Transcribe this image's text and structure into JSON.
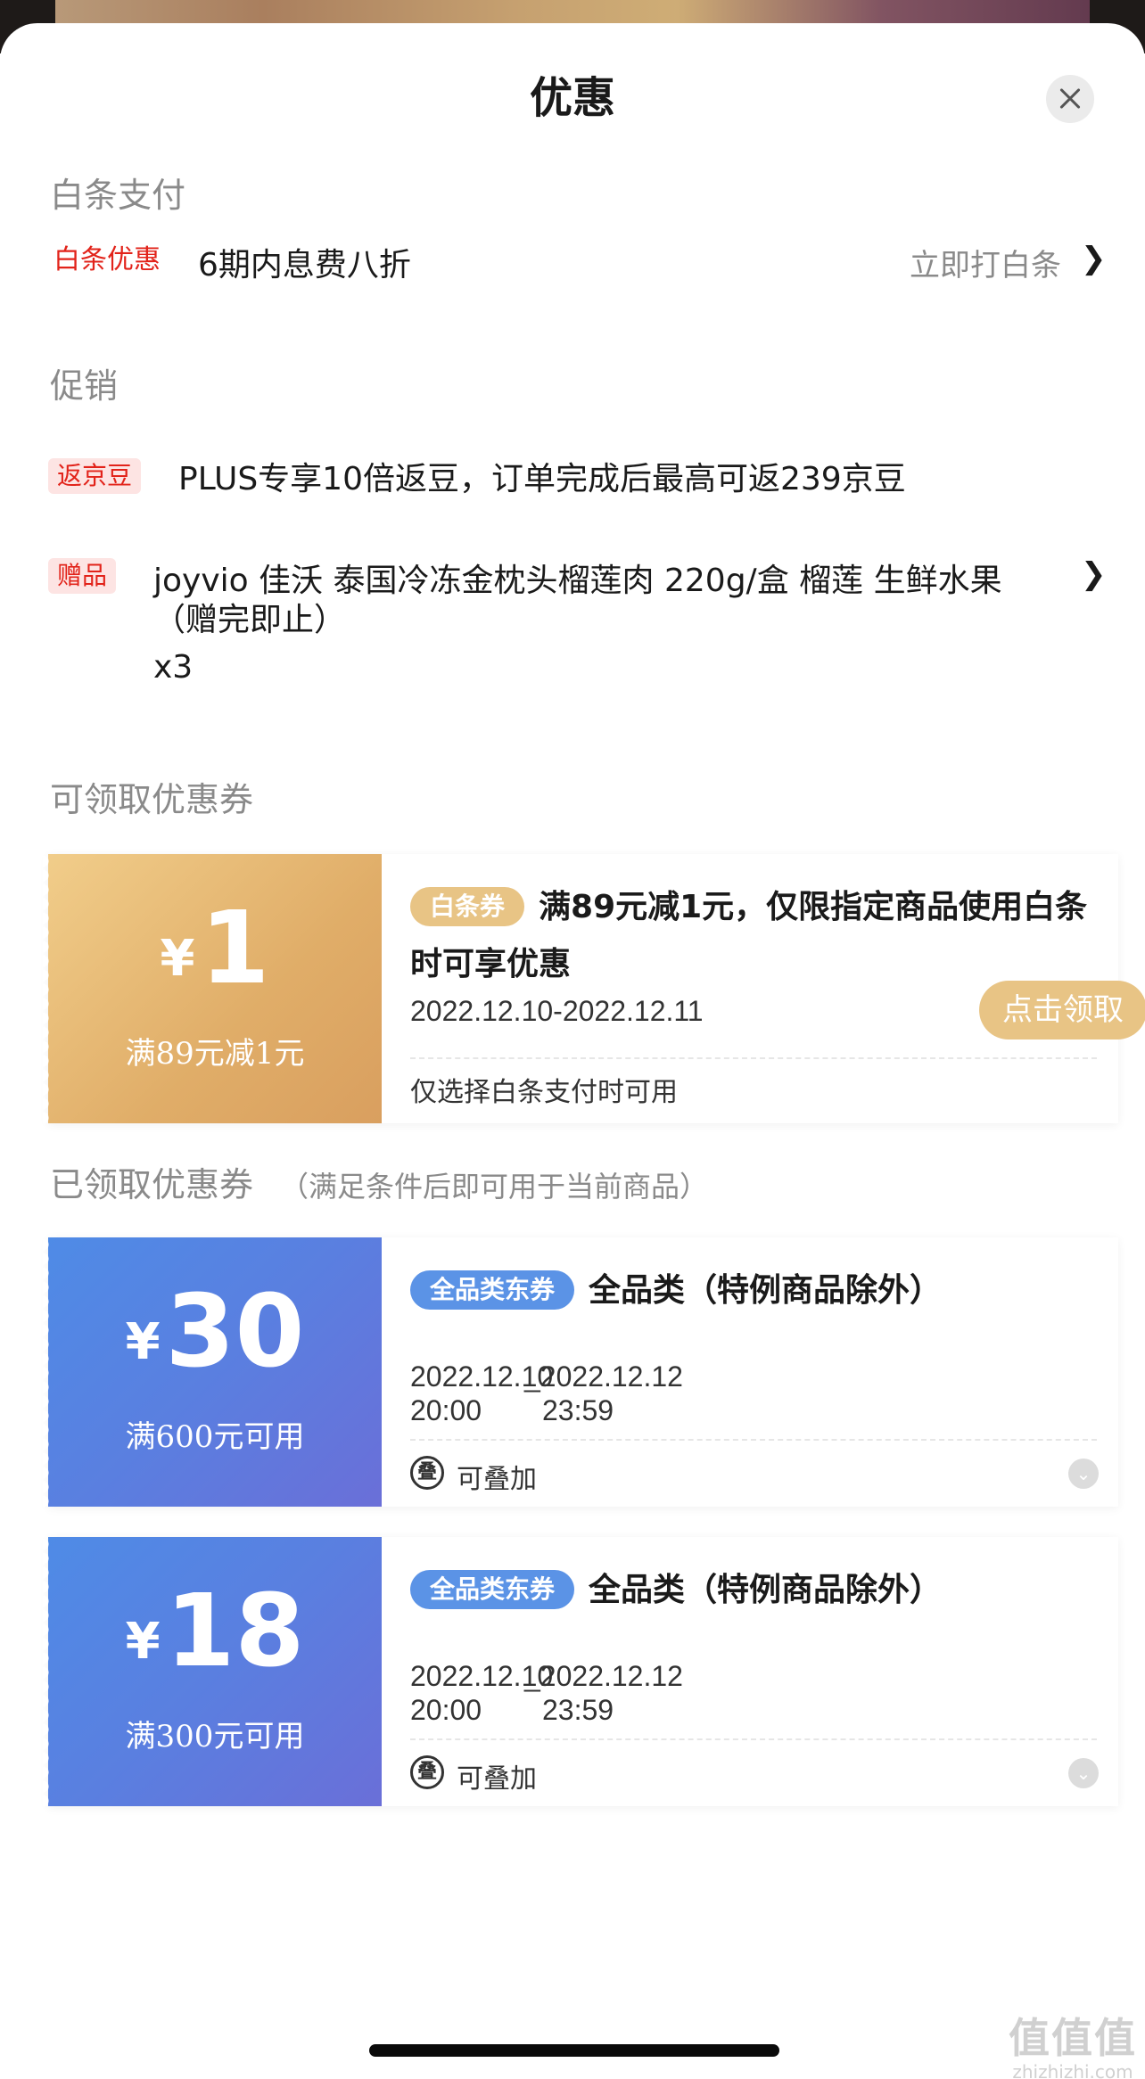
{
  "header": {
    "title": "优惠"
  },
  "baitiao": {
    "section_label": "白条支付",
    "tag": "白条优惠",
    "text": "6期内息费八折",
    "action": "立即打白条",
    "chevron": "❯"
  },
  "promo": {
    "section_label": "促销",
    "items": [
      {
        "tag": "返京豆",
        "text": "PLUS专享10倍返豆，订单完成后最高可返239京豆"
      },
      {
        "tag": "赠品",
        "line1": "joyvio 佳沃 泰国冷冻金枕头榴莲肉 220g/盒 榴莲 生鲜水果",
        "line2": "（赠完即止）",
        "qty": "x3",
        "chevron": "❯"
      }
    ]
  },
  "available": {
    "section_label": "可领取优惠券",
    "coupon": {
      "currency": "¥",
      "amount": "1",
      "condition": "满89元减1元",
      "badge": "白条券",
      "title": "满89元减1元，仅限指定商品使用白条时可享优惠",
      "date": "2022.12.10-2022.12.11",
      "claim_button": "点击领取",
      "note": "仅选择白条支付时可用"
    }
  },
  "received": {
    "section_label": "已领取优惠券",
    "note": "（满足条件后即可用于当前商品）",
    "coupons": [
      {
        "currency": "¥",
        "amount": "30",
        "condition": "满600元可用",
        "badge": "全品类东券",
        "title": "全品类（特例商品除外）",
        "start_date": "2022.12.10",
        "start_time": "20:00",
        "end_date": "2022.12.12",
        "end_time": "23:59",
        "stack_icon": "叠",
        "stack": "可叠加"
      },
      {
        "currency": "¥",
        "amount": "18",
        "condition": "满300元可用",
        "badge": "全品类东券",
        "title": "全品类（特例商品除外）",
        "start_date": "2022.12.10",
        "start_time": "20:00",
        "end_date": "2022.12.12",
        "end_time": "23:59",
        "stack_icon": "叠",
        "stack": "可叠加"
      }
    ]
  },
  "watermark": {
    "mark": "值值值",
    "site": "zhizhizhi.com"
  },
  "colors": {
    "brand_red": "#e2231a",
    "gold": "#e8c485",
    "blue": "#5b93e6"
  }
}
